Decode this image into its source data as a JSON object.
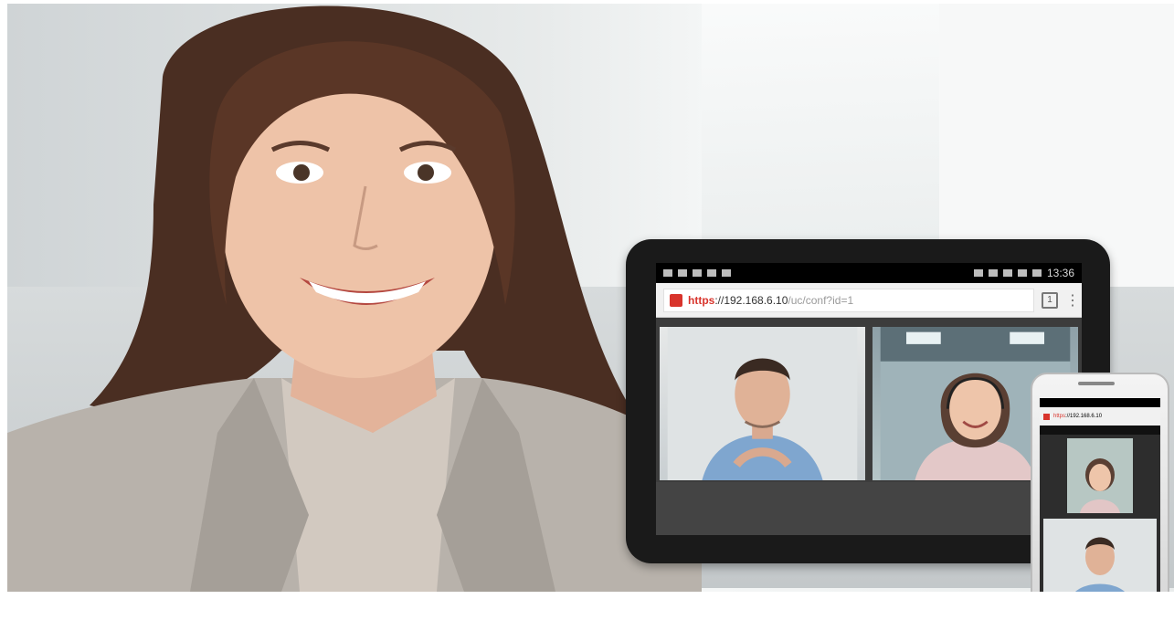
{
  "tablet": {
    "status_time": "13:36",
    "url": {
      "scheme": "https",
      "host": "://192.168.6.10",
      "path": "/uc/conf?id=1"
    },
    "tabs_count": "1",
    "menu_glyph": "⋮"
  },
  "phone": {
    "url": {
      "scheme": "https",
      "host": "://192.168.6.10"
    }
  },
  "colors": {
    "url_scheme": "#d8342c",
    "tablet_body": "#1a1a1a"
  }
}
